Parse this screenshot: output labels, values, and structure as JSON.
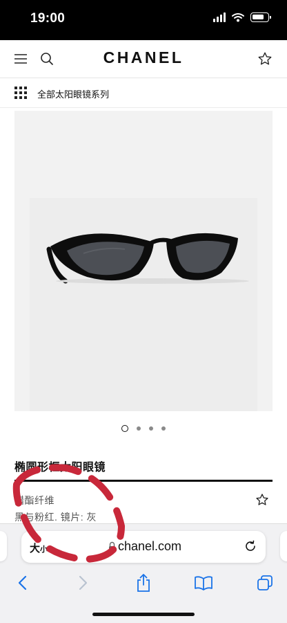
{
  "status_bar": {
    "time": "19:00",
    "battery_level": 0.8
  },
  "header": {
    "logo": "CHANEL",
    "icons": [
      "menu-icon",
      "search-icon",
      "star-icon"
    ]
  },
  "category_nav": {
    "label": "全部太阳眼镜系列",
    "icon": "grid-icon"
  },
  "product": {
    "title": "椭圆形框太阳眼镜",
    "material": "醋酯纤维",
    "colorway": "黑与粉红. 镜片: 灰",
    "image_count": 4,
    "active_image": 1
  },
  "browser": {
    "text_size_label": "大",
    "text_size_small": "小",
    "url": "chanel.com",
    "toolbar_icons": [
      "back-icon",
      "forward-icon",
      "share-icon",
      "bookmarks-icon",
      "tabs-icon"
    ]
  },
  "colors": {
    "lens": "#4c4f55",
    "frame": "#0d0d0d",
    "ios_blue": "#1a73e8",
    "annotation_red": "#c8283a"
  }
}
